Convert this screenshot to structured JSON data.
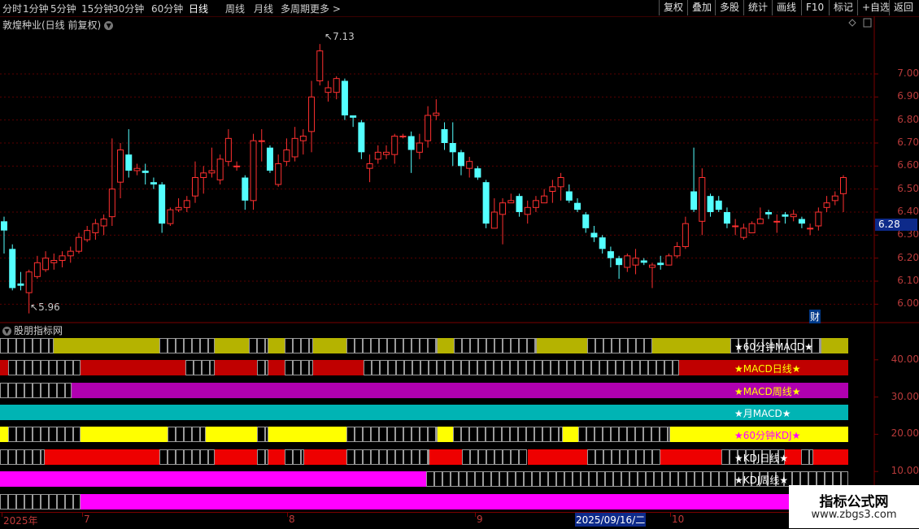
{
  "toolbar": {
    "periods": [
      "分时",
      "1分钟",
      "5分钟",
      "15分钟",
      "30分钟",
      "60分钟",
      "日线",
      "周线",
      "月线",
      "多周期",
      "更多 >"
    ],
    "active_period": "日线",
    "actions": [
      "复权",
      "叠加",
      "多股",
      "统计",
      "画线",
      "F10",
      "标记",
      "+自选",
      "返回"
    ]
  },
  "chart_header": {
    "title": "敦煌种业(日线 前复权)"
  },
  "indicator_header": {
    "title": "股朋指标网"
  },
  "price_axis": {
    "labels": [
      "7.00",
      "6.90",
      "6.80",
      "6.70",
      "6.60",
      "6.50",
      "6.40",
      "6.30",
      "6.20",
      "6.10",
      "6.00"
    ],
    "current": "6.28"
  },
  "indicator_axis": {
    "labels": [
      "40.00",
      "30.00",
      "20.00",
      "10.00"
    ]
  },
  "annotations": {
    "high": "7.13",
    "low": "5.96",
    "finance_icon_text": "财"
  },
  "date_axis": {
    "ticks": [
      "2025年",
      "7",
      "8",
      "9",
      "10"
    ],
    "selected": "2025/09/16/二"
  },
  "signal_rows": [
    {
      "label": "★60分钟MACD★",
      "label_color": "#ffffff",
      "on_color": "#b5b300"
    },
    {
      "label": "★MACD日线★",
      "label_color": "#ffff00",
      "on_color": "#c00000"
    },
    {
      "label": "★MACD周线★",
      "label_color": "#ffff00",
      "on_color": "#b000b0"
    },
    {
      "label": "★月MACD★",
      "label_color": "#ffffff",
      "on_color": "#00b4b4"
    },
    {
      "label": "★60分钟KDJ★",
      "label_color": "#ff00ff",
      "on_color": "#ffff00"
    },
    {
      "label": "★KDJ日线★",
      "label_color": "#ffffff",
      "on_color": "#ee0000"
    },
    {
      "label": "★KDJ周线★",
      "label_color": "#ffffff",
      "on_color": "#ff00ff"
    },
    {
      "label": "★KDJ月线★",
      "label_color": "#ff00ff",
      "on_color": "#ff00ff"
    }
  ],
  "watermark": {
    "title": "指标公式网",
    "url": "www.zbgs3.com"
  },
  "chart_data": {
    "type": "candlestick",
    "y_axis_range": [
      5.92,
      7.18
    ],
    "candles": [
      [
        6.36,
        6.32,
        6.38,
        6.22
      ],
      [
        6.24,
        6.07,
        6.26,
        6.06
      ],
      [
        6.09,
        6.08,
        6.14,
        6.06
      ],
      [
        6.05,
        6.14,
        6.15,
        5.96
      ],
      [
        6.12,
        6.18,
        6.21,
        6.11
      ],
      [
        6.15,
        6.2,
        6.23,
        6.14
      ],
      [
        6.18,
        6.19,
        6.22,
        6.15
      ],
      [
        6.19,
        6.21,
        6.23,
        6.16
      ],
      [
        6.21,
        6.23,
        6.25,
        6.18
      ],
      [
        6.23,
        6.29,
        6.31,
        6.22
      ],
      [
        6.28,
        6.32,
        6.34,
        6.27
      ],
      [
        6.31,
        6.35,
        6.37,
        6.28
      ],
      [
        6.34,
        6.37,
        6.39,
        6.3
      ],
      [
        6.38,
        6.5,
        6.72,
        6.34
      ],
      [
        6.53,
        6.67,
        6.7,
        6.46
      ],
      [
        6.65,
        6.58,
        6.76,
        6.55
      ],
      [
        6.58,
        6.59,
        6.61,
        6.56
      ],
      [
        6.58,
        6.57,
        6.61,
        6.52
      ],
      [
        6.53,
        6.52,
        6.55,
        6.5
      ],
      [
        6.52,
        6.35,
        6.53,
        6.31
      ],
      [
        6.35,
        6.41,
        6.42,
        6.34
      ],
      [
        6.41,
        6.42,
        6.46,
        6.4
      ],
      [
        6.42,
        6.45,
        6.47,
        6.4
      ],
      [
        6.47,
        6.55,
        6.62,
        6.44
      ],
      [
        6.55,
        6.57,
        6.6,
        6.48
      ],
      [
        6.57,
        6.58,
        6.68,
        6.55
      ],
      [
        6.54,
        6.63,
        6.65,
        6.52
      ],
      [
        6.62,
        6.72,
        6.76,
        6.6
      ],
      [
        6.6,
        6.6,
        6.62,
        6.58
      ],
      [
        6.55,
        6.45,
        6.56,
        6.41
      ],
      [
        6.45,
        6.71,
        6.74,
        6.41
      ],
      [
        6.71,
        6.71,
        6.76,
        6.62
      ],
      [
        6.68,
        6.58,
        6.69,
        6.57
      ],
      [
        6.52,
        6.61,
        6.65,
        6.51
      ],
      [
        6.62,
        6.67,
        6.72,
        6.6
      ],
      [
        6.64,
        6.72,
        6.77,
        6.62
      ],
      [
        6.71,
        6.73,
        6.76,
        6.65
      ],
      [
        6.75,
        6.9,
        6.97,
        6.66
      ],
      [
        6.97,
        7.1,
        7.13,
        6.95
      ],
      [
        6.92,
        6.94,
        6.97,
        6.88
      ],
      [
        6.92,
        6.98,
        6.99,
        6.89
      ],
      [
        6.97,
        6.82,
        6.98,
        6.8
      ],
      [
        6.82,
        6.81,
        6.82,
        6.77
      ],
      [
        6.79,
        6.66,
        6.8,
        6.63
      ],
      [
        6.59,
        6.61,
        6.65,
        6.53
      ],
      [
        6.63,
        6.66,
        6.69,
        6.61
      ],
      [
        6.65,
        6.66,
        6.69,
        6.63
      ],
      [
        6.65,
        6.73,
        6.74,
        6.61
      ],
      [
        6.73,
        6.73,
        6.74,
        6.72
      ],
      [
        6.73,
        6.67,
        6.75,
        6.57
      ],
      [
        6.66,
        6.7,
        6.74,
        6.63
      ],
      [
        6.71,
        6.82,
        6.86,
        6.68
      ],
      [
        6.82,
        6.83,
        6.89,
        6.8
      ],
      [
        6.76,
        6.7,
        6.79,
        6.67
      ],
      [
        6.7,
        6.66,
        6.79,
        6.6
      ],
      [
        6.66,
        6.6,
        6.67,
        6.56
      ],
      [
        6.59,
        6.62,
        6.64,
        6.55
      ],
      [
        6.59,
        6.55,
        6.6,
        6.54
      ],
      [
        6.53,
        6.35,
        6.54,
        6.33
      ],
      [
        6.33,
        6.4,
        6.46,
        6.33
      ],
      [
        6.39,
        6.44,
        6.46,
        6.26
      ],
      [
        6.44,
        6.45,
        6.48,
        6.44
      ],
      [
        6.47,
        6.4,
        6.48,
        6.38
      ],
      [
        6.39,
        6.42,
        6.45,
        6.35
      ],
      [
        6.42,
        6.45,
        6.47,
        6.4
      ],
      [
        6.44,
        6.47,
        6.5,
        6.44
      ],
      [
        6.49,
        6.51,
        6.54,
        6.44
      ],
      [
        6.51,
        6.55,
        6.57,
        6.45
      ],
      [
        6.49,
        6.45,
        6.52,
        6.44
      ],
      [
        6.44,
        6.41,
        6.46,
        6.4
      ],
      [
        6.39,
        6.33,
        6.4,
        6.31
      ],
      [
        6.31,
        6.29,
        6.34,
        6.27
      ],
      [
        6.29,
        6.24,
        6.3,
        6.22
      ],
      [
        6.23,
        6.2,
        6.25,
        6.16
      ],
      [
        6.2,
        6.17,
        6.21,
        6.11
      ],
      [
        6.16,
        6.21,
        6.22,
        6.14
      ],
      [
        6.17,
        6.2,
        6.24,
        6.13
      ],
      [
        6.19,
        6.18,
        6.2,
        6.17
      ],
      [
        6.16,
        6.17,
        6.18,
        6.07
      ],
      [
        6.18,
        6.17,
        6.21,
        6.15
      ],
      [
        6.17,
        6.21,
        6.22,
        6.17
      ],
      [
        6.21,
        6.25,
        6.27,
        6.2
      ],
      [
        6.25,
        6.35,
        6.38,
        6.24
      ],
      [
        6.49,
        6.41,
        6.68,
        6.4
      ],
      [
        6.36,
        6.55,
        6.59,
        6.3
      ],
      [
        6.47,
        6.4,
        6.48,
        6.38
      ],
      [
        6.45,
        6.41,
        6.47,
        6.4
      ],
      [
        6.4,
        6.35,
        6.42,
        6.33
      ],
      [
        6.34,
        6.34,
        6.37,
        6.3
      ],
      [
        6.29,
        6.33,
        6.35,
        6.28
      ],
      [
        6.31,
        6.35,
        6.36,
        6.31
      ],
      [
        6.35,
        6.37,
        6.42,
        6.35
      ],
      [
        6.4,
        6.39,
        6.41,
        6.37
      ],
      [
        6.36,
        6.36,
        6.39,
        6.31
      ],
      [
        6.39,
        6.38,
        6.4,
        6.35
      ],
      [
        6.38,
        6.39,
        6.41,
        6.36
      ],
      [
        6.37,
        6.35,
        6.38,
        6.33
      ],
      [
        6.33,
        6.33,
        6.35,
        6.3
      ],
      [
        6.34,
        6.4,
        6.42,
        6.32
      ],
      [
        6.42,
        6.44,
        6.47,
        6.4
      ],
      [
        6.45,
        6.47,
        6.49,
        6.43
      ],
      [
        6.48,
        6.55,
        6.56,
        6.4
      ]
    ],
    "candle_fields": [
      "open",
      "close",
      "high",
      "low"
    ],
    "bull_color": "#ff3030",
    "bear_color": "#54ffff",
    "signal_segments": [
      [
        [
          0,
          66,
          0
        ],
        [
          66,
          196,
          1
        ],
        [
          196,
          264,
          0
        ],
        [
          264,
          306,
          1
        ],
        [
          306,
          330,
          0
        ],
        [
          330,
          350,
          1
        ],
        [
          350,
          385,
          0
        ],
        [
          385,
          426,
          1
        ],
        [
          426,
          538,
          0
        ],
        [
          538,
          558,
          1
        ],
        [
          558,
          660,
          0
        ],
        [
          660,
          722,
          1
        ],
        [
          722,
          802,
          0
        ],
        [
          802,
          898,
          1
        ],
        [
          898,
          1010,
          0
        ],
        [
          1010,
          1043,
          1
        ]
      ],
      [
        [
          0,
          10,
          1
        ],
        [
          10,
          99,
          0
        ],
        [
          99,
          228,
          1
        ],
        [
          228,
          264,
          0
        ],
        [
          264,
          316,
          1
        ],
        [
          316,
          330,
          0
        ],
        [
          330,
          350,
          1
        ],
        [
          350,
          385,
          0
        ],
        [
          385,
          447,
          1
        ],
        [
          447,
          835,
          0
        ],
        [
          835,
          1043,
          1
        ]
      ],
      [
        [
          0,
          88,
          0
        ],
        [
          88,
          1043,
          1
        ]
      ],
      [
        [
          0,
          1043,
          1
        ]
      ],
      [
        [
          0,
          10,
          1
        ],
        [
          10,
          99,
          0
        ],
        [
          99,
          206,
          1
        ],
        [
          206,
          253,
          0
        ],
        [
          253,
          316,
          1
        ],
        [
          316,
          330,
          0
        ],
        [
          330,
          426,
          1
        ],
        [
          426,
          538,
          0
        ],
        [
          538,
          557,
          1
        ],
        [
          557,
          692,
          0
        ],
        [
          692,
          711,
          1
        ],
        [
          711,
          824,
          0
        ],
        [
          824,
          1043,
          1
        ]
      ],
      [
        [
          0,
          55,
          0
        ],
        [
          55,
          196,
          1
        ],
        [
          196,
          264,
          0
        ],
        [
          264,
          316,
          1
        ],
        [
          316,
          330,
          0
        ],
        [
          330,
          350,
          1
        ],
        [
          350,
          374,
          0
        ],
        [
          374,
          426,
          1
        ],
        [
          426,
          528,
          0
        ],
        [
          528,
          568,
          1
        ],
        [
          568,
          649,
          0
        ],
        [
          649,
          722,
          1
        ],
        [
          722,
          812,
          0
        ],
        [
          812,
          887,
          1
        ],
        [
          887,
          965,
          0
        ],
        [
          965,
          985,
          1
        ],
        [
          985,
          1000,
          0
        ],
        [
          1000,
          1043,
          1
        ]
      ],
      [
        [
          0,
          524,
          1
        ],
        [
          524,
          1043,
          0
        ]
      ],
      [
        [
          0,
          99,
          0
        ],
        [
          99,
          1043,
          1
        ]
      ]
    ]
  }
}
